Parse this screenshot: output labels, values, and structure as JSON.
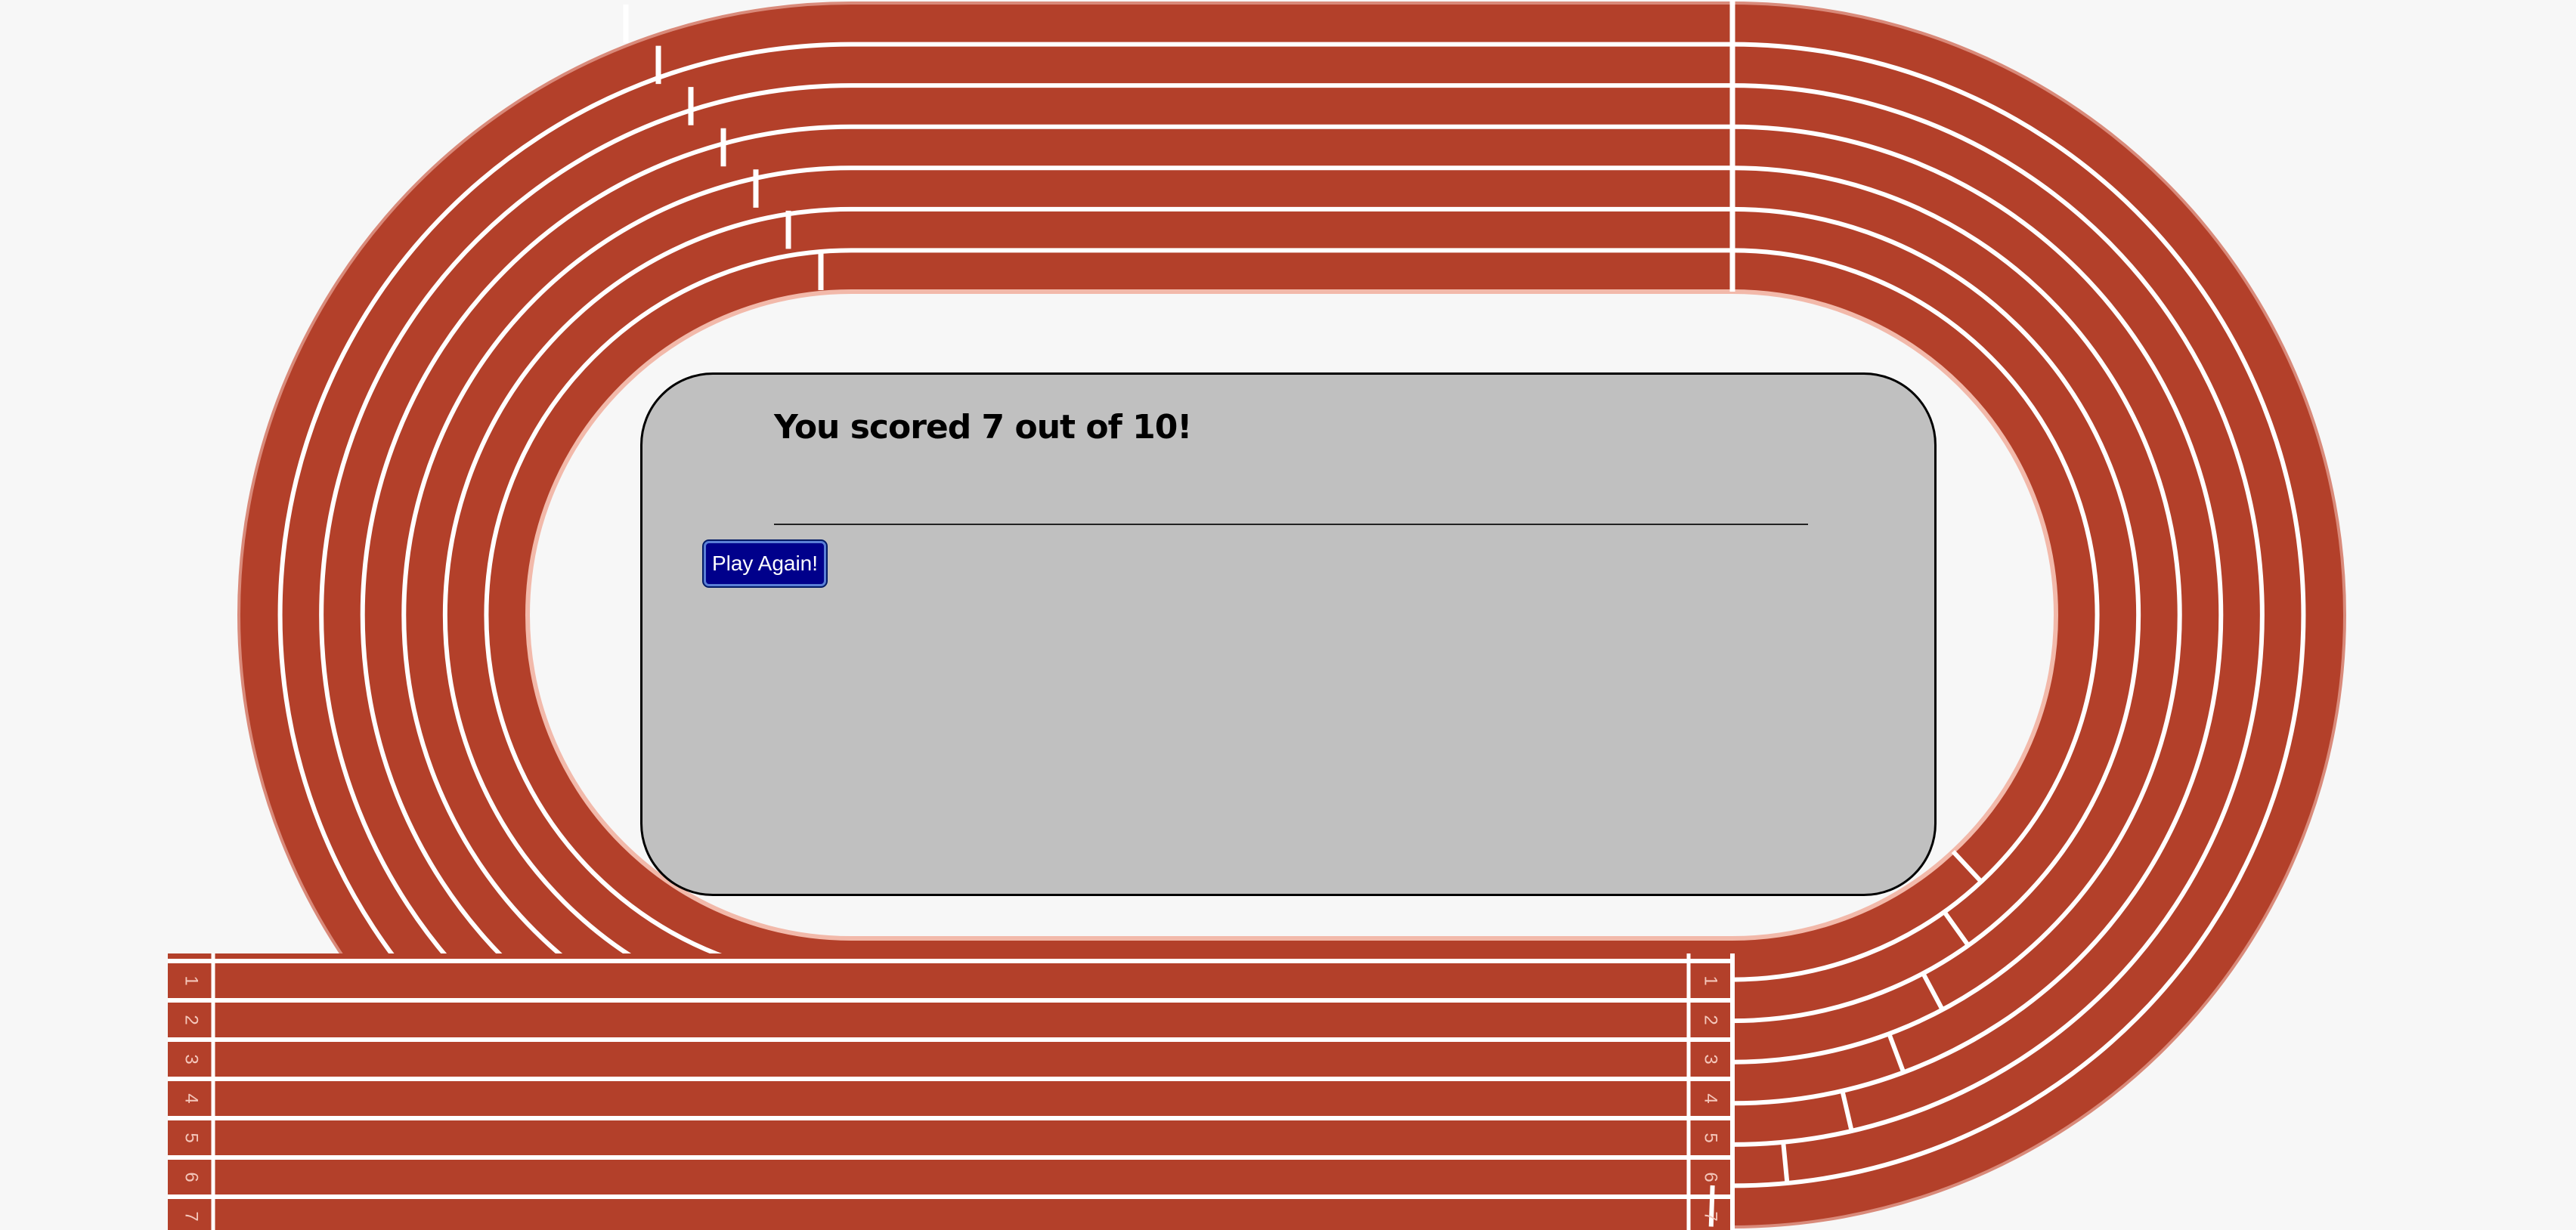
{
  "game": {
    "result_text": "You scored 7 out of 10!",
    "play_again_label": "Play Again!",
    "score": 7,
    "total": 10
  },
  "track": {
    "lane_numbers": [
      "1",
      "2",
      "3",
      "4",
      "5",
      "6",
      "7"
    ],
    "colors": {
      "surface": "#b3402a",
      "lines": "#ffffff",
      "infield": "#f7f7f7",
      "card": "#c0c0c0",
      "button": "#00008b"
    }
  }
}
